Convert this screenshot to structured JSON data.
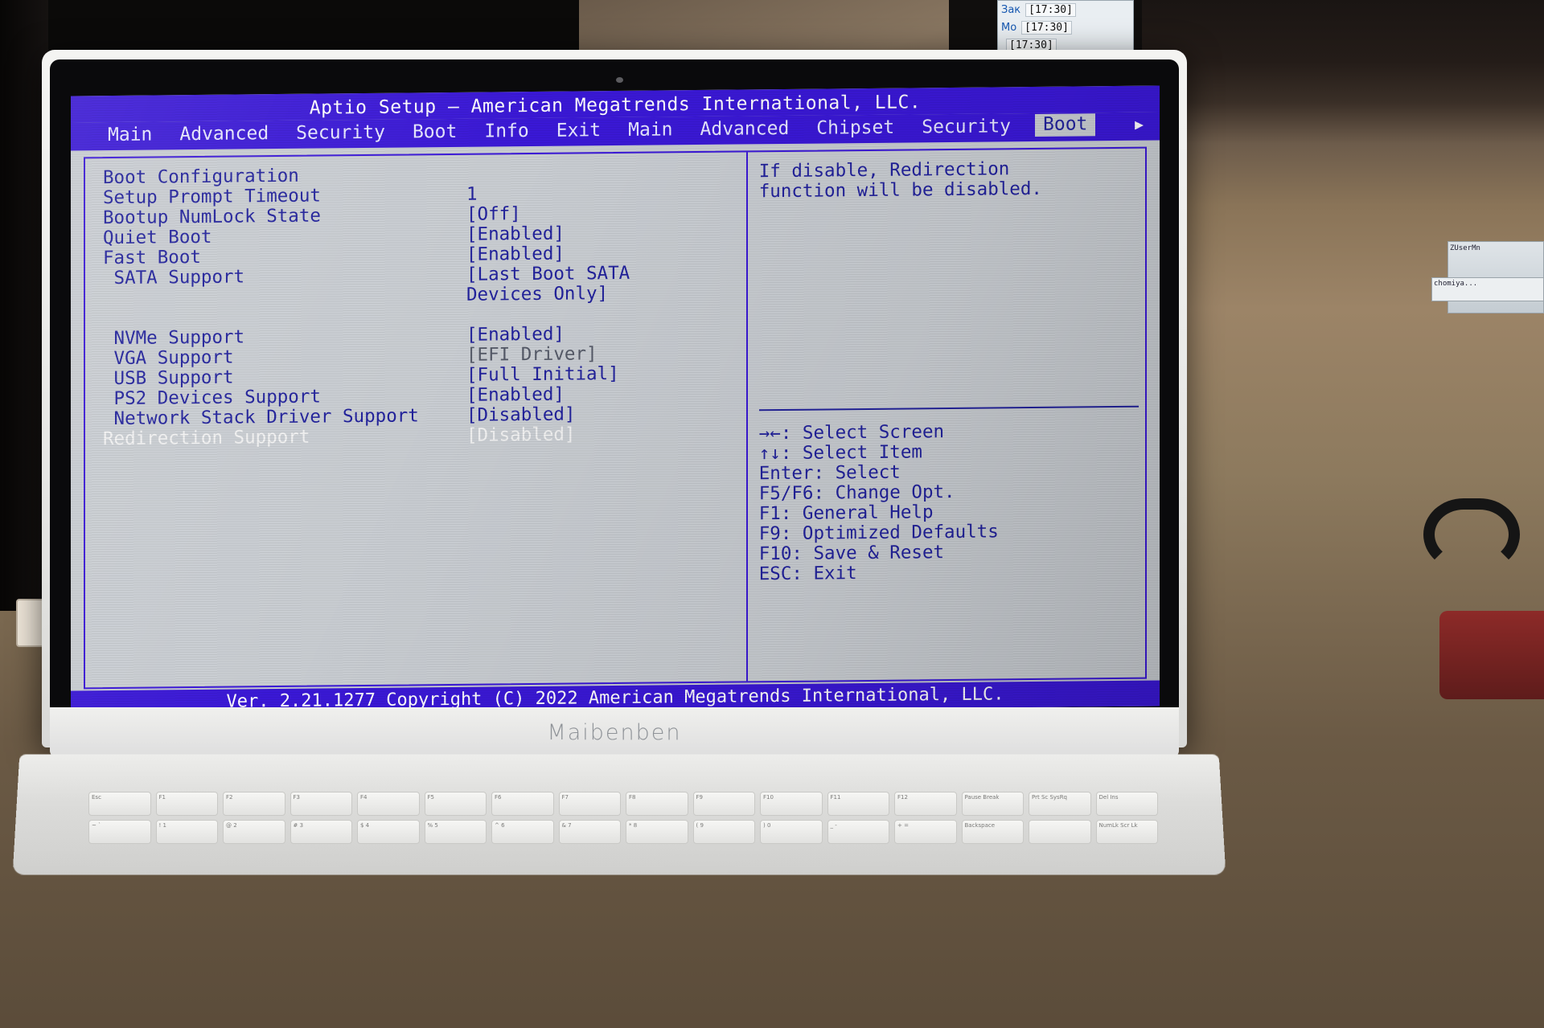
{
  "desktop": {
    "clock_rows": [
      {
        "label": "Зак",
        "value": "[17:30]"
      },
      {
        "label": "Mo",
        "value": "[17:30]"
      },
      {
        "label": "",
        "value": "[17:30]"
      }
    ],
    "side_panel_text": "ZUserMn",
    "side_panel_text2": "chomiya..."
  },
  "laptop": {
    "brand": "Maibenben"
  },
  "bios": {
    "title": "Aptio Setup – American Megatrends International, LLC.",
    "tabs": [
      {
        "label": "Main",
        "active": false
      },
      {
        "label": "Advanced",
        "active": false
      },
      {
        "label": "Security",
        "active": false
      },
      {
        "label": "Boot",
        "active": false
      },
      {
        "label": "Info",
        "active": false
      },
      {
        "label": "Exit",
        "active": false
      },
      {
        "label": "Main",
        "active": false
      },
      {
        "label": "Advanced",
        "active": false
      },
      {
        "label": "Chipset",
        "active": false
      },
      {
        "label": "Security",
        "active": false
      },
      {
        "label": "Boot",
        "active": true
      }
    ],
    "tab_overflow_arrow": "▶",
    "section_heading": "Boot Configuration",
    "items": [
      {
        "label": "Setup Prompt Timeout",
        "value": "1",
        "indent": 0,
        "selected": false,
        "dim": false
      },
      {
        "label": "Bootup NumLock State",
        "value": "[Off]",
        "indent": 0,
        "selected": false,
        "dim": false
      },
      {
        "label": "Quiet Boot",
        "value": "[Enabled]",
        "indent": 0,
        "selected": false,
        "dim": false
      },
      {
        "label": "Fast Boot",
        "value": "[Enabled]",
        "indent": 0,
        "selected": false,
        "dim": false
      },
      {
        "label": "SATA Support",
        "value": "[Last Boot SATA",
        "indent": 1,
        "selected": false,
        "dim": false
      },
      {
        "label": "",
        "value": "Devices Only]",
        "indent": 0,
        "selected": false,
        "dim": false
      },
      {
        "label": "",
        "value": "",
        "indent": 0,
        "selected": false,
        "dim": false
      },
      {
        "label": "NVMe Support",
        "value": "[Enabled]",
        "indent": 1,
        "selected": false,
        "dim": false
      },
      {
        "label": "VGA Support",
        "value": "[EFI Driver]",
        "indent": 1,
        "selected": false,
        "dim": true
      },
      {
        "label": "USB Support",
        "value": "[Full Initial]",
        "indent": 1,
        "selected": false,
        "dim": false
      },
      {
        "label": "PS2 Devices Support",
        "value": "[Enabled]",
        "indent": 1,
        "selected": false,
        "dim": false
      },
      {
        "label": "Network Stack Driver Support",
        "value": "[Disabled]",
        "indent": 1,
        "selected": false,
        "dim": false
      },
      {
        "label": "Redirection Support",
        "value": "[Disabled]",
        "indent": 0,
        "selected": true,
        "dim": false
      }
    ],
    "help": "If disable, Redirection\nfunction will be disabled.",
    "legend": [
      "→←: Select Screen",
      "↑↓: Select Item",
      "Enter: Select",
      "F5/F6: Change Opt.",
      "F1: General Help",
      "F9: Optimized Defaults",
      "F10: Save & Reset",
      "ESC: Exit"
    ],
    "footer": "Ver. 2.21.1277 Copyright (C) 2022 American Megatrends International, LLC."
  },
  "keyboard": {
    "keys": [
      "Esc",
      "F1",
      "F2",
      "F3",
      "F4",
      "F5",
      "F6",
      "F7",
      "F8",
      "F9",
      "F10",
      "F11",
      "F12",
      "Pause Break",
      "Prt Sc SysRq",
      "Del Ins",
      "~ `",
      "! 1",
      "@ 2",
      "# 3",
      "$ 4",
      "% 5",
      "^ 6",
      "& 7",
      "* 8",
      "( 9",
      ") 0",
      "_ -",
      "+ =",
      "Backspace",
      "",
      "NumLk Scr Lk"
    ]
  }
}
